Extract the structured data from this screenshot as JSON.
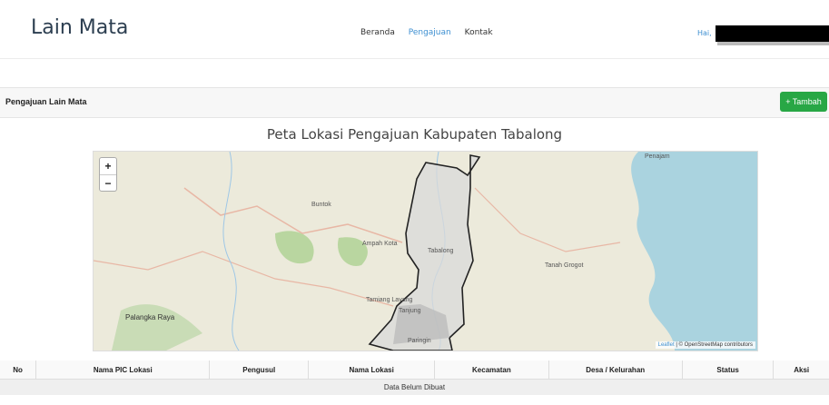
{
  "header": {
    "brand": "Lain Mata",
    "nav": [
      "Beranda",
      "Pengajuan",
      "Kontak"
    ],
    "greeting": "Hai,"
  },
  "toolbar": {
    "title": "Pengajuan Lain Mata",
    "add_button": "+ Tambah"
  },
  "map": {
    "title": "Peta Lokasi Pengajuan Kabupaten Tabalong",
    "zoom_in": "+",
    "zoom_out": "−",
    "attribution_leaflet": "Leaflet",
    "attribution_rest": "| © OpenStreetMap contributors",
    "places": [
      "Palangka Raya",
      "Buntok",
      "Ampah Kota",
      "Tamiang Layang",
      "Tanjung",
      "Paringin",
      "Tabalong",
      "Tanah Grogot",
      "Penajam"
    ]
  },
  "table": {
    "columns": [
      "No",
      "Nama PIC Lokasi",
      "Pengusul",
      "Nama Lokasi",
      "Kecamatan",
      "Desa / Kelurahan",
      "Status",
      "Aksi"
    ],
    "empty_text": "Data Belum Dibuat"
  },
  "colors": {
    "accent": "#3d8fd1",
    "success": "#28a745",
    "sea": "#aad3df"
  }
}
